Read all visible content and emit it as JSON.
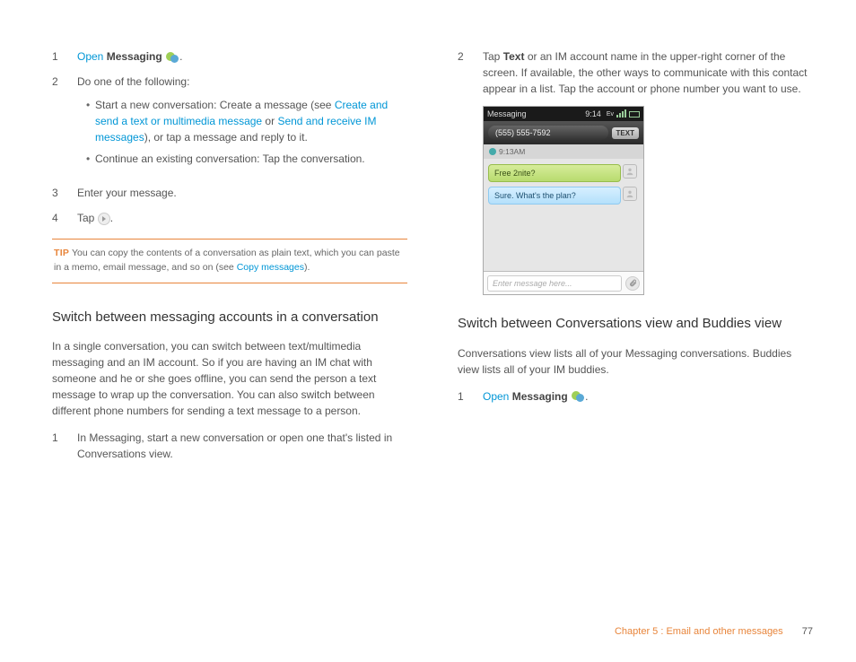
{
  "left": {
    "step1_num": "1",
    "step1_open": "Open",
    "step1_app": "Messaging",
    "step2_num": "2",
    "step2_text": "Do one of the following:",
    "bullet1_a": "Start a new conversation: Create a message (see ",
    "bullet1_link1": "Create and send a text or multimedia message",
    "bullet1_b": " or ",
    "bullet1_link2": "Send and receive IM messages",
    "bullet1_c": "), or tap a message and reply to it.",
    "bullet2": "Continue an existing conversation: Tap the conversation.",
    "step3_num": "3",
    "step3_text": "Enter your message.",
    "step4_num": "4",
    "step4_text": "Tap ",
    "tip_label": "TIP",
    "tip_a": "You can copy the contents of a conversation as plain text, which you can paste in a memo, email message, and so on (see ",
    "tip_link": "Copy messages",
    "tip_b": ").",
    "heading1": "Switch between messaging accounts in a conversation",
    "para1": "In a single conversation, you can switch between text/multimedia messaging and an IM account. So if you are having an IM chat with someone and he or she goes offline, you can send the person a text message to wrap up the conversation. You can also switch between different phone numbers for sending a text message to a person.",
    "l_step1_num": "1",
    "l_step1_text": "In Messaging, start a new conversation or open one that's listed in Conversations view."
  },
  "right": {
    "step2_num": "2",
    "step2_a": "Tap ",
    "step2_bold": "Text",
    "step2_b": " or an IM account name in the upper-right corner of the screen. If available, the other ways to communicate with this contact appear in a list. Tap the account or phone number you want to use.",
    "heading2": "Switch between Conversations view and Buddies view",
    "para2": "Conversations view lists all of your Messaging conversations. Buddies view lists all of your IM buddies.",
    "r_step1_num": "1",
    "r_step1_open": "Open",
    "r_step1_app": "Messaging"
  },
  "phone": {
    "status_app": "Messaging",
    "status_time": "9:14",
    "contact": "(555) 555-7592",
    "text_button": "TEXT",
    "timestamp": "9:13AM",
    "msg_out": "Free 2nite?",
    "msg_in": "Sure. What's the plan?",
    "input_placeholder": "Enter message here..."
  },
  "footer": {
    "chapter": "Chapter 5 : Email and other messages",
    "page": "77"
  }
}
